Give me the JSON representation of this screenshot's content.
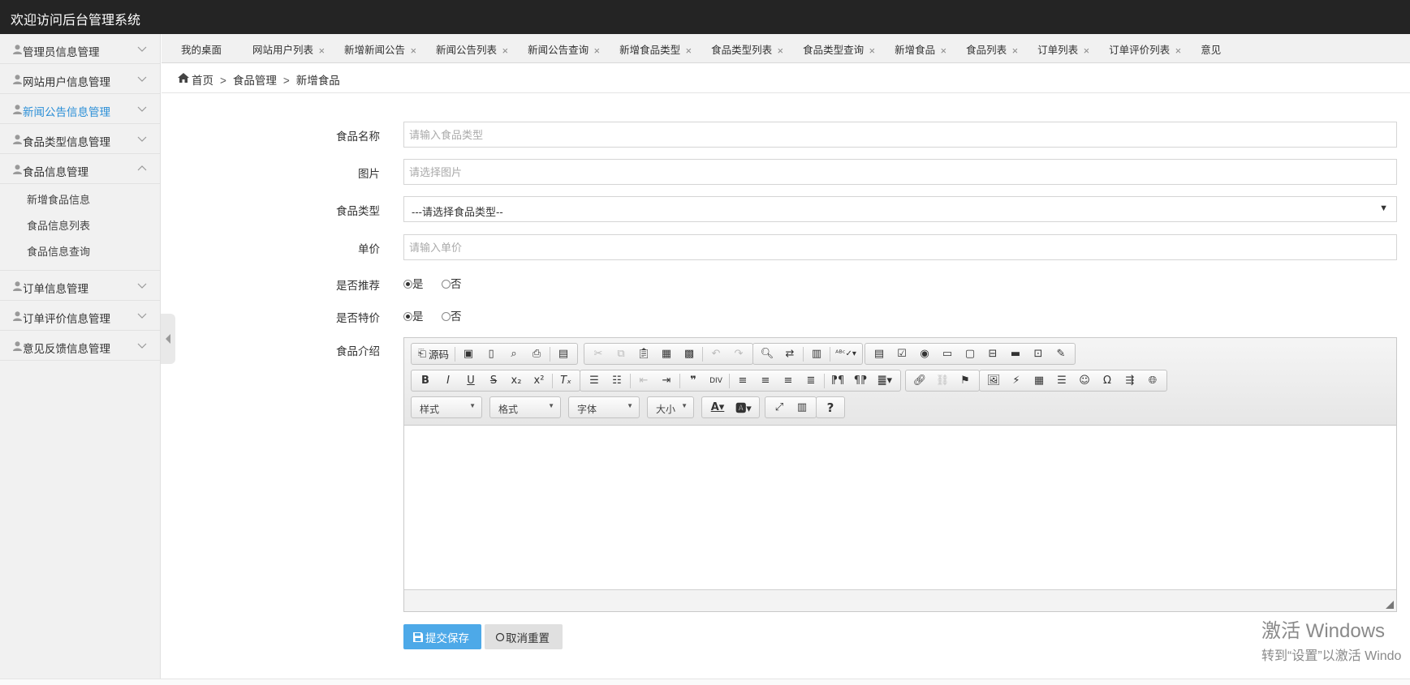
{
  "header": {
    "title": "欢迎访问后台管理系统"
  },
  "sidebar": {
    "items": [
      {
        "label": "管理员信息管理"
      },
      {
        "label": "网站用户信息管理"
      },
      {
        "label": "新闻公告信息管理"
      },
      {
        "label": "食品类型信息管理"
      },
      {
        "label": "食品信息管理"
      },
      {
        "label": "订单信息管理"
      },
      {
        "label": "订单评价信息管理"
      },
      {
        "label": "意见反馈信息管理"
      }
    ],
    "active_index": 2,
    "expanded_index": 4,
    "submenu": [
      {
        "label": "新增食品信息"
      },
      {
        "label": "食品信息列表"
      },
      {
        "label": "食品信息查询"
      }
    ]
  },
  "tabs": [
    {
      "label": "我的桌面",
      "closable": false
    },
    {
      "label": "网站用户列表",
      "closable": true
    },
    {
      "label": "新增新闻公告",
      "closable": true
    },
    {
      "label": "新闻公告列表",
      "closable": true
    },
    {
      "label": "新闻公告查询",
      "closable": true
    },
    {
      "label": "新增食品类型",
      "closable": true
    },
    {
      "label": "食品类型列表",
      "closable": true
    },
    {
      "label": "食品类型查询",
      "closable": true
    },
    {
      "label": "新增食品",
      "closable": true,
      "active": true
    },
    {
      "label": "食品列表",
      "closable": true
    },
    {
      "label": "订单列表",
      "closable": true
    },
    {
      "label": "订单评价列表",
      "closable": true
    },
    {
      "label": "意见",
      "closable": false
    }
  ],
  "breadcrumb": {
    "home": "首页",
    "sep": ">",
    "level1": "食品管理",
    "level2": "新增食品"
  },
  "form": {
    "name": {
      "label": "食品名称",
      "placeholder": "请输入食品类型"
    },
    "image": {
      "label": "图片",
      "placeholder": "请选择图片"
    },
    "type": {
      "label": "食品类型",
      "value": "---请选择食品类型--"
    },
    "price": {
      "label": "单价",
      "placeholder": "请输入单价"
    },
    "recommend": {
      "label": "是否推荐",
      "yes": "是",
      "no": "否",
      "selected": "yes"
    },
    "special": {
      "label": "是否特价",
      "yes": "是",
      "no": "否",
      "selected": "yes"
    },
    "intro": {
      "label": "食品介绍"
    }
  },
  "editor": {
    "source_label": "源码",
    "combos": {
      "style": "样式",
      "format": "格式",
      "font": "字体",
      "size": "大小"
    }
  },
  "buttons": {
    "save": "提交保存",
    "reset": "取消重置"
  },
  "watermark": {
    "line1": "激活 Windows",
    "line2": "转到“设置”以激活 Windo"
  },
  "colors": {
    "header_bg": "#242424",
    "accent": "#2b8fd7",
    "save_btn": "#4da9e8"
  }
}
